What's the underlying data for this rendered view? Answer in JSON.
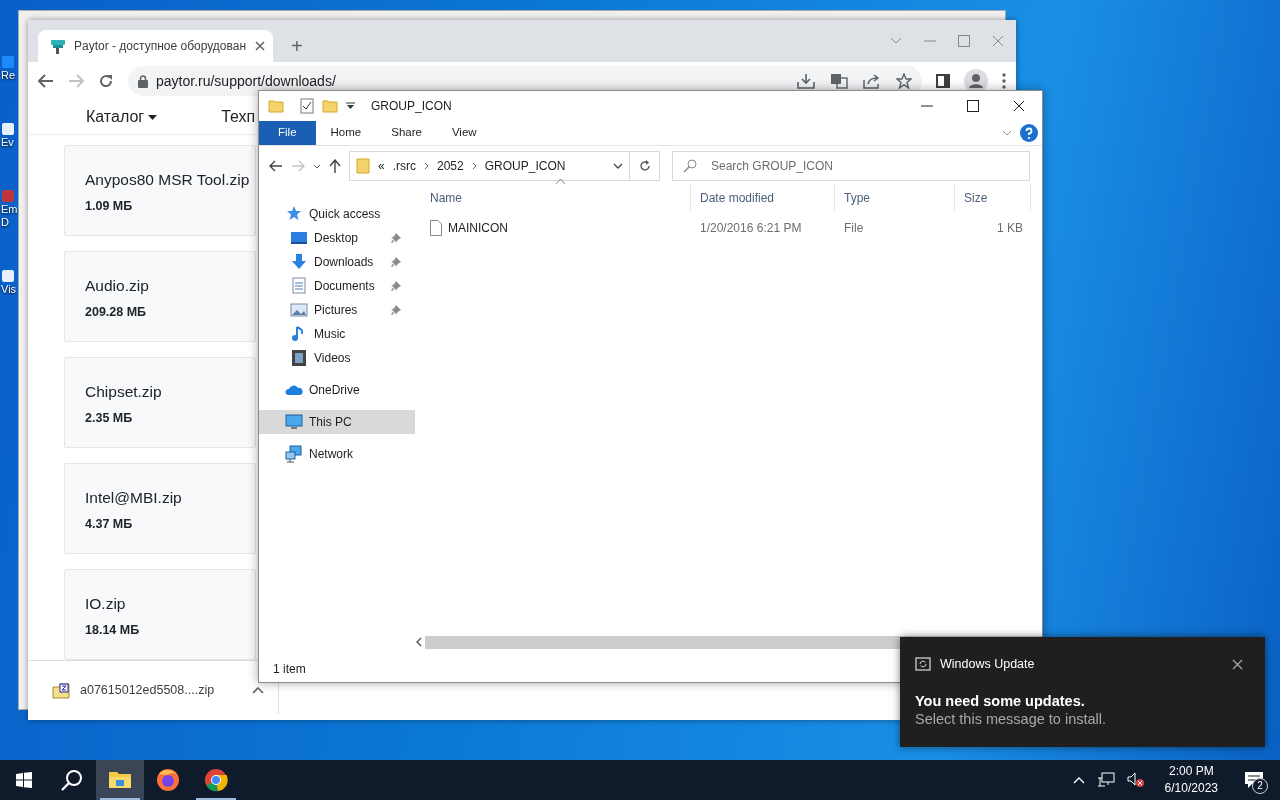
{
  "desktop_icons": [
    {
      "lines": [
        "Re"
      ]
    },
    {
      "lines": [
        "Ev"
      ]
    },
    {
      "lines": [
        "Em",
        "D"
      ]
    },
    {
      "lines": [
        "Vis"
      ]
    }
  ],
  "browser": {
    "tab": {
      "title": "Paytor - доступное оборудован",
      "selected": true
    },
    "new_tab": "+",
    "url": "paytor.ru/support/downloads/",
    "nav": [
      {
        "label": "Каталог",
        "dropdown": true
      },
      {
        "label": "Техп",
        "dropdown": false
      }
    ],
    "files": [
      {
        "name": "Anypos80 MSR Tool.zip",
        "size": "1.09 МБ"
      },
      {
        "name": "Audio.zip",
        "size": "209.28 МБ"
      },
      {
        "name": "Chipset.zip",
        "size": "2.35 МБ"
      },
      {
        "name": "Intel@MBI.zip",
        "size": "4.37 МБ"
      },
      {
        "name": "IO.zip",
        "size": "18.14 МБ"
      }
    ],
    "download": {
      "name": "a07615012ed5508....zip"
    }
  },
  "explorer": {
    "title": "GROUP_ICON",
    "ribbon_tabs": [
      {
        "label": "File",
        "selected": true
      },
      {
        "label": "Home",
        "selected": false
      },
      {
        "label": "Share",
        "selected": false
      },
      {
        "label": "View",
        "selected": false
      }
    ],
    "breadcrumb_overflow": "«",
    "path": [
      ".rsrc",
      "2052",
      "GROUP_ICON"
    ],
    "search": {
      "placeholder": "Search GROUP_ICON"
    },
    "sidebar": [
      {
        "kind": "star",
        "label": "Quick access",
        "selected": false,
        "children": [
          {
            "kind": "desktop",
            "label": "Desktop",
            "pinned": true,
            "selected": false
          },
          {
            "kind": "downloads",
            "label": "Downloads",
            "pinned": true,
            "selected": false
          },
          {
            "kind": "documents",
            "label": "Documents",
            "pinned": true,
            "selected": false
          },
          {
            "kind": "pictures",
            "label": "Pictures",
            "pinned": true,
            "selected": false
          },
          {
            "kind": "music",
            "label": "Music",
            "pinned": false,
            "selected": false
          },
          {
            "kind": "videos",
            "label": "Videos",
            "pinned": false,
            "selected": false
          }
        ]
      },
      {
        "kind": "cloud",
        "label": "OneDrive",
        "selected": false
      },
      {
        "kind": "pc",
        "label": "This PC",
        "selected": true
      },
      {
        "kind": "network",
        "label": "Network",
        "selected": false
      }
    ],
    "columns": [
      "Name",
      "Date modified",
      "Type",
      "Size"
    ],
    "rows": [
      {
        "name": "MAINICON",
        "date": "1/20/2016 6:21 PM",
        "type": "File",
        "size": "1 KB"
      }
    ],
    "status": "1 item"
  },
  "notification": {
    "app": "Windows Update",
    "title": "You need some updates.",
    "body": "Select this message to install."
  },
  "taskbar": {
    "apps": [
      {
        "kind": "explorer",
        "active": true,
        "running": true
      },
      {
        "kind": "firefox",
        "active": false,
        "running": false
      },
      {
        "kind": "chrome",
        "active": false,
        "running": true
      }
    ],
    "time": "2:00 PM",
    "date": "6/10/2023",
    "notification_count": "2"
  }
}
